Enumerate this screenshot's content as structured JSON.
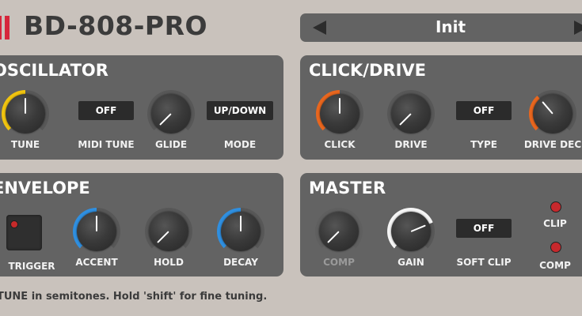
{
  "app": {
    "title": "BD-808-PRO"
  },
  "preset": {
    "name": "Init",
    "prev_icon": "triangle-left",
    "next_icon": "triangle-right"
  },
  "colors": {
    "yellow": "#f1c40f",
    "orange": "#e8661e",
    "blue": "#2f8fe0",
    "white": "#f5f5f5",
    "led_red": "#c7282c"
  },
  "oscillator": {
    "title": "OSCILLATOR",
    "tune": {
      "label": "TUNE",
      "value_fraction": 0.5
    },
    "midi_tune": {
      "label": "MIDI TUNE",
      "state": "OFF"
    },
    "glide": {
      "label": "GLIDE",
      "value_fraction": 0.0
    },
    "mode": {
      "label": "MODE",
      "state": "UP/DOWN"
    }
  },
  "click_drive": {
    "title": "CLICK/DRIVE",
    "click": {
      "label": "CLICK",
      "value_fraction": 0.5
    },
    "drive": {
      "label": "DRIVE",
      "value_fraction": 0.0
    },
    "type": {
      "label": "TYPE",
      "state": "OFF"
    },
    "drive_decay": {
      "label": "DRIVE DEC",
      "value_fraction": 0.35
    }
  },
  "envelope": {
    "title": "ENVELOPE",
    "trigger": {
      "label": "TRIGGER"
    },
    "accent": {
      "label": "ACCENT",
      "value_fraction": 0.5
    },
    "hold": {
      "label": "HOLD",
      "value_fraction": 0.0
    },
    "decay": {
      "label": "DECAY",
      "value_fraction": 0.5
    }
  },
  "master": {
    "title": "MASTER",
    "comp": {
      "label": "COMP",
      "value_fraction": 0.0
    },
    "gain": {
      "label": "GAIN",
      "value_fraction": 0.75
    },
    "soft_clip": {
      "label": "SOFT CLIP",
      "state": "OFF"
    },
    "clip_led": {
      "label": "CLIP"
    },
    "comp_led": {
      "label": "COMP"
    }
  },
  "hint": "TUNE in semitones. Hold 'shift' for fine tuning."
}
